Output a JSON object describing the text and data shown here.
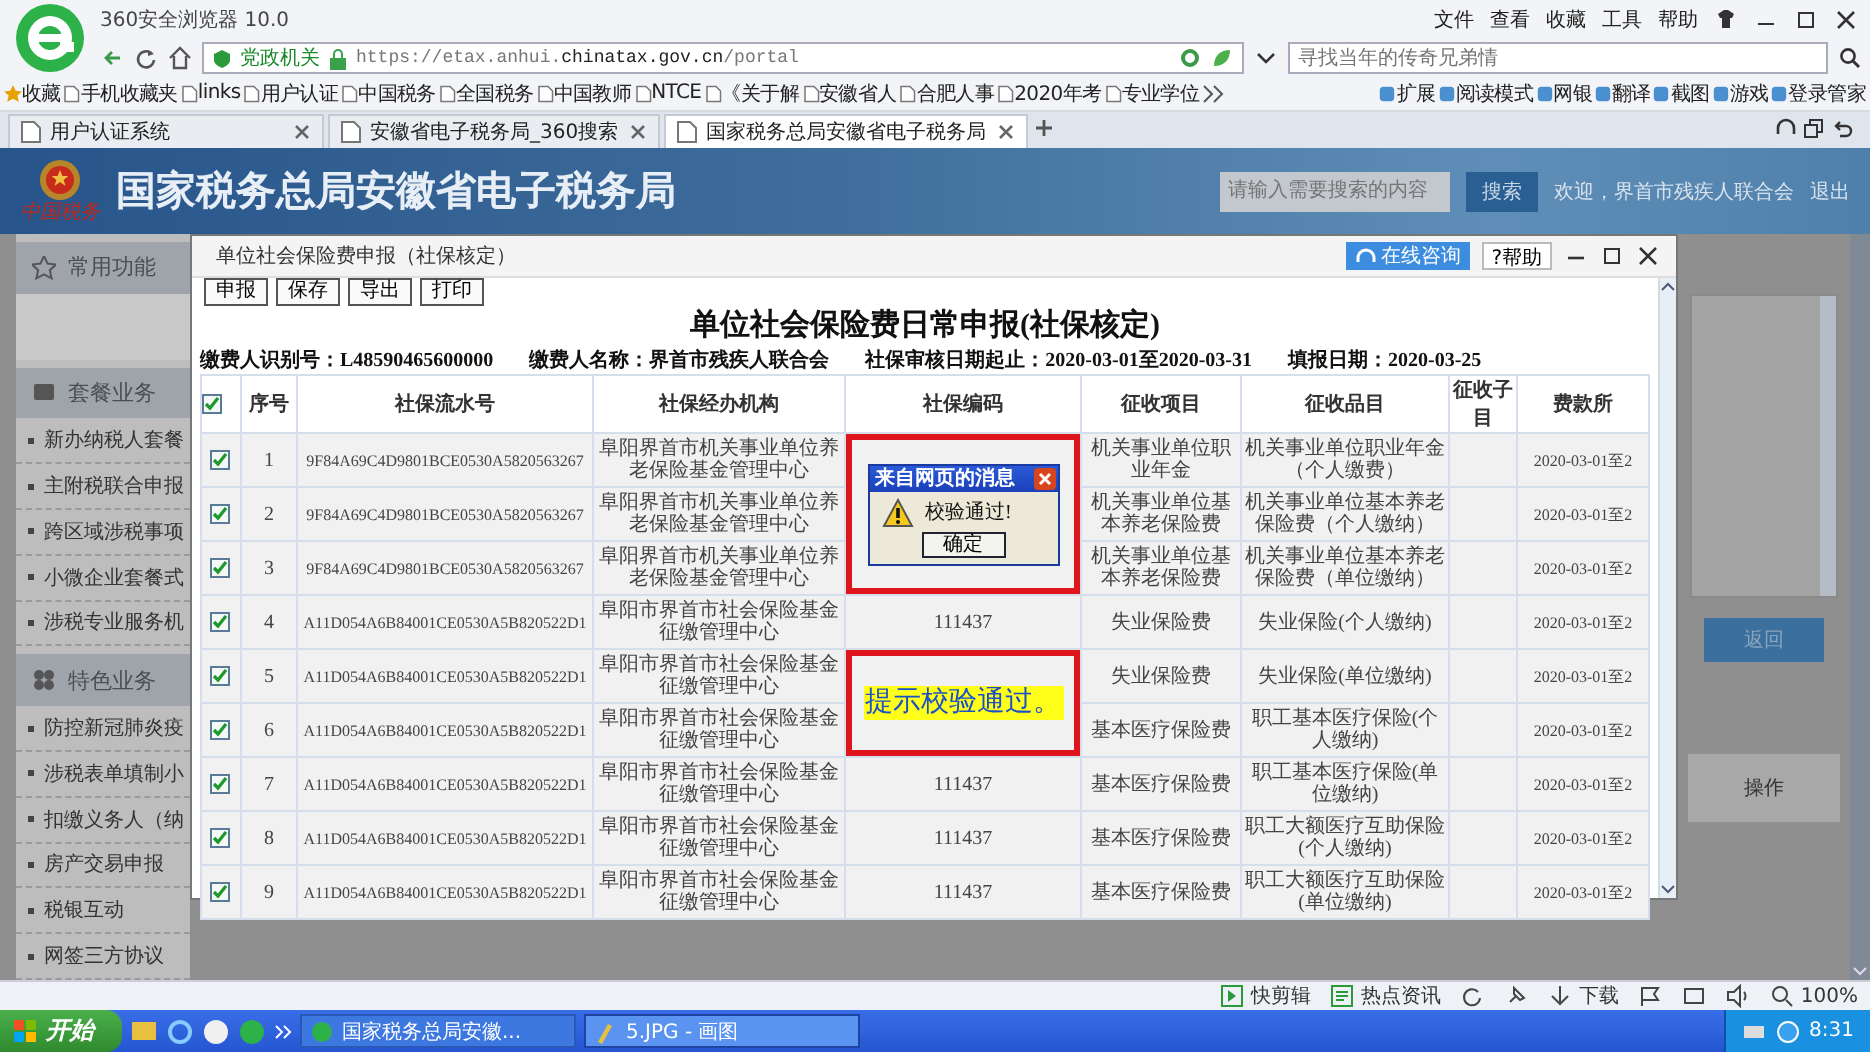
{
  "browser": {
    "title": "360安全浏览器 10.0",
    "menu": [
      "文件",
      "查看",
      "收藏",
      "工具",
      "帮助"
    ],
    "badge": "党政机关",
    "url": "https://etax.anhui.**chinatax.gov.cn**/portal",
    "search": {
      "placeholder": "寻找当年的传奇兄弟情"
    }
  },
  "bookmarks": [
    {
      "label": "收藏"
    },
    {
      "label": "手机收藏夹"
    },
    {
      "label": "links"
    },
    {
      "label": "用户认证"
    },
    {
      "label": "中国税务"
    },
    {
      "label": "全国税务"
    },
    {
      "label": "中国教师"
    },
    {
      "label": "NTCE"
    },
    {
      "label": "《关于解"
    },
    {
      "label": "安徽省人"
    },
    {
      "label": "合肥人事"
    },
    {
      "label": "2020年考"
    },
    {
      "label": "专业学位"
    }
  ],
  "extensions": [
    {
      "label": "扩展"
    },
    {
      "label": "阅读模式"
    },
    {
      "label": "网银"
    },
    {
      "label": "翻译"
    },
    {
      "label": "截图"
    },
    {
      "label": "游戏"
    },
    {
      "label": "登录管家"
    }
  ],
  "tabs": [
    {
      "label": "用户认证系统",
      "selected": false
    },
    {
      "label": "安徽省电子税务局_360搜索",
      "selected": false
    },
    {
      "label": "国家税务总局安徽省电子税务局",
      "selected": true
    }
  ],
  "site": {
    "logo_caption": "中国税务",
    "title": "国家税务总局安徽省电子税务局",
    "search": {
      "placeholder": "请输入需要搜索的内容"
    },
    "search_button": "搜索",
    "welcome": "欢迎，界首市残疾人联合会",
    "logout": "退出"
  },
  "sidebar": {
    "sections": [
      {
        "label": "常用功能"
      },
      {
        "label": "套餐业务",
        "items": [
          "新办纳税人套餐",
          "主附税联合申报",
          "跨区域涉税事项",
          "小微企业套餐式",
          "涉税专业服务机"
        ]
      },
      {
        "label": "特色业务",
        "items": [
          "防控新冠肺炎疫",
          "涉税表单填制小",
          "扣缴义务人（纳",
          "房产交易申报",
          "税银互动",
          "网签三方协议"
        ]
      }
    ]
  },
  "right_panel": {
    "button": "返回",
    "column": "操作"
  },
  "modal": {
    "title": "单位社会保险费申报（社保核定）",
    "consult_button": "在线咨询",
    "help_button": "?帮助",
    "toolbar": [
      "申报",
      "保存",
      "导出",
      "打印"
    ],
    "heading": "单位社会保险费日常申报(社保核定)",
    "info": [
      "缴费人识别号：L48590465600000",
      "缴费人名称：界首市残疾人联合会",
      "社保审核日期起止：2020-03-01至2020-03-31",
      "填报日期：2020-03-25"
    ],
    "table": {
      "all_checked": true,
      "columns": [
        "序号",
        "社保流水号",
        "社保经办机构",
        "社保编码",
        "征收项目",
        "征收品目",
        "征收子目",
        "费款所"
      ],
      "rows": [
        {
          "checked": true,
          "index": "1",
          "serial": "9F84A69C4D9801BCE0530A5820563267",
          "agency": "阜阳界首市机关事业单位养老保险基金管理中心",
          "item": "机关事业单位职业年金",
          "category": "机关事业单位职业年金（个人缴费）",
          "period": "2020-03-01至2"
        },
        {
          "checked": true,
          "index": "2",
          "serial": "9F84A69C4D9801BCE0530A5820563267",
          "agency": "阜阳界首市机关事业单位养老保险基金管理中心",
          "item": "机关事业单位基本养老保险费",
          "category": "机关事业单位基本养老保险费（个人缴纳）",
          "period": "2020-03-01至2"
        },
        {
          "checked": true,
          "index": "3",
          "serial": "9F84A69C4D9801BCE0530A5820563267",
          "agency": "阜阳界首市机关事业单位养老保险基金管理中心",
          "item": "机关事业单位基本养老保险费",
          "category": "机关事业单位基本养老保险费（单位缴纳）",
          "period": "2020-03-01至2"
        },
        {
          "checked": true,
          "index": "4",
          "serial": "A11D054A6B84001CE0530A5B820522D1",
          "agency": "阜阳市界首市社会保险基金征缴管理中心",
          "code": "111437",
          "item": "失业保险费",
          "category": "失业保险(个人缴纳)",
          "period": "2020-03-01至2"
        },
        {
          "checked": true,
          "index": "5",
          "serial": "A11D054A6B84001CE0530A5B820522D1",
          "agency": "阜阳市界首市社会保险基金征缴管理中心",
          "item": "失业保险费",
          "category": "失业保险(单位缴纳)",
          "period": "2020-03-01至2"
        },
        {
          "checked": true,
          "index": "6",
          "serial": "A11D054A6B84001CE0530A5B820522D1",
          "agency": "阜阳市界首市社会保险基金征缴管理中心",
          "item": "基本医疗保险费",
          "category": "职工基本医疗保险(个人缴纳)",
          "period": "2020-03-01至2"
        },
        {
          "checked": true,
          "index": "7",
          "serial": "A11D054A6B84001CE0530A5B820522D1",
          "agency": "阜阳市界首市社会保险基金征缴管理中心",
          "code": "111437",
          "item": "基本医疗保险费",
          "category": "职工基本医疗保险(单位缴纳)",
          "period": "2020-03-01至2"
        },
        {
          "checked": true,
          "index": "8",
          "serial": "A11D054A6B84001CE0530A5B820522D1",
          "agency": "阜阳市界首市社会保险基金征缴管理中心",
          "code": "111437",
          "item": "基本医疗保险费",
          "category": "职工大额医疗互助保险(个人缴纳)",
          "period": "2020-03-01至2"
        },
        {
          "checked": true,
          "index": "9",
          "serial": "A11D054A6B84001CE0530A5B820522D1",
          "agency": "阜阳市界首市社会保险基金征缴管理中心",
          "code": "111437",
          "item": "基本医疗保险费",
          "category": "职工大额医疗互助保险(单位缴纳)",
          "period": "2020-03-01至2"
        }
      ]
    },
    "alert": {
      "title": "来自网页的消息",
      "message": "校验通过!",
      "ok": "确定"
    },
    "annotation": "提示校验通过。"
  },
  "status_bar": [
    {
      "label": "快剪辑"
    },
    {
      "label": "热点资讯"
    },
    {
      "label": "下载"
    },
    {
      "label": "100%"
    }
  ],
  "taskbar": {
    "start": "开始",
    "tasks": [
      {
        "label": "国家税务总局安徽...",
        "selected": false
      },
      {
        "label": "5.JPG - 画图",
        "selected": true
      }
    ],
    "clock": "8:31"
  }
}
